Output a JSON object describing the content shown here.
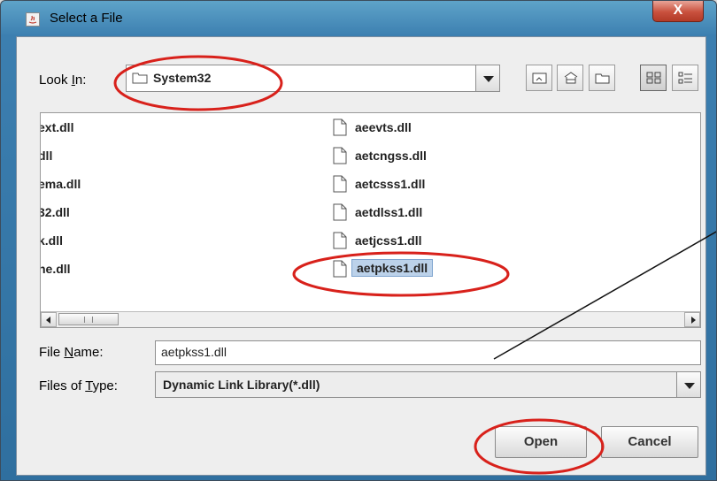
{
  "window": {
    "title": "Select a File",
    "close_label": "X"
  },
  "look_in": {
    "label_pre": "Look ",
    "label_mnemonic": "I",
    "label_post": "n:",
    "value": "System32"
  },
  "toolbar": {
    "icons": [
      "up-one-level-icon",
      "home-icon",
      "new-folder-icon",
      "list-view-icon",
      "details-view-icon"
    ]
  },
  "files_left": [
    "ext.dll",
    "dll",
    "ema.dll",
    "32.dll",
    "k.dll",
    "he.dll"
  ],
  "files_right": [
    "aeevts.dll",
    "aetcngss.dll",
    "aetcsss1.dll",
    "aetdlss1.dll",
    "aetjcss1.dll",
    "aetpkss1.dll"
  ],
  "selected_file": "aetpkss1.dll",
  "file_name": {
    "label_pre": "File ",
    "label_mnemonic": "N",
    "label_post": "ame:",
    "value": "aetpkss1.dll"
  },
  "file_type": {
    "label_pre": "Files of ",
    "label_mnemonic": "T",
    "label_post": "ype:",
    "value": "Dynamic Link Library(*.dll)"
  },
  "buttons": {
    "open": "Open",
    "cancel": "Cancel"
  },
  "colors": {
    "annotation": "#d8211b",
    "titlebar": "#3c7fb0",
    "selection": "#bcd2ea"
  }
}
